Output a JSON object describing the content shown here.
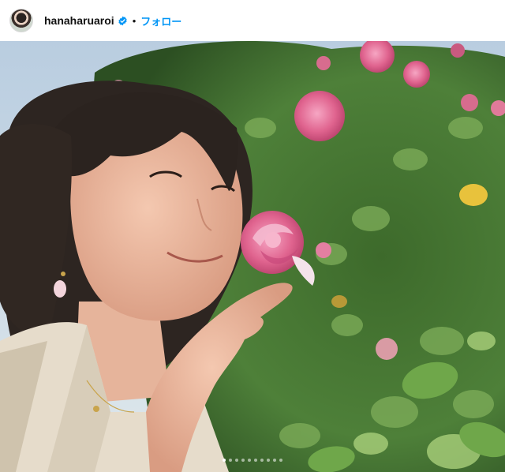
{
  "post": {
    "username": "hanaharuaroi",
    "separator": "•",
    "follow_label": "フォロー",
    "verified_icon": "verified-badge-icon",
    "accent_color": "#0095f6",
    "carousel": {
      "count": 10,
      "active_index": 0
    }
  }
}
